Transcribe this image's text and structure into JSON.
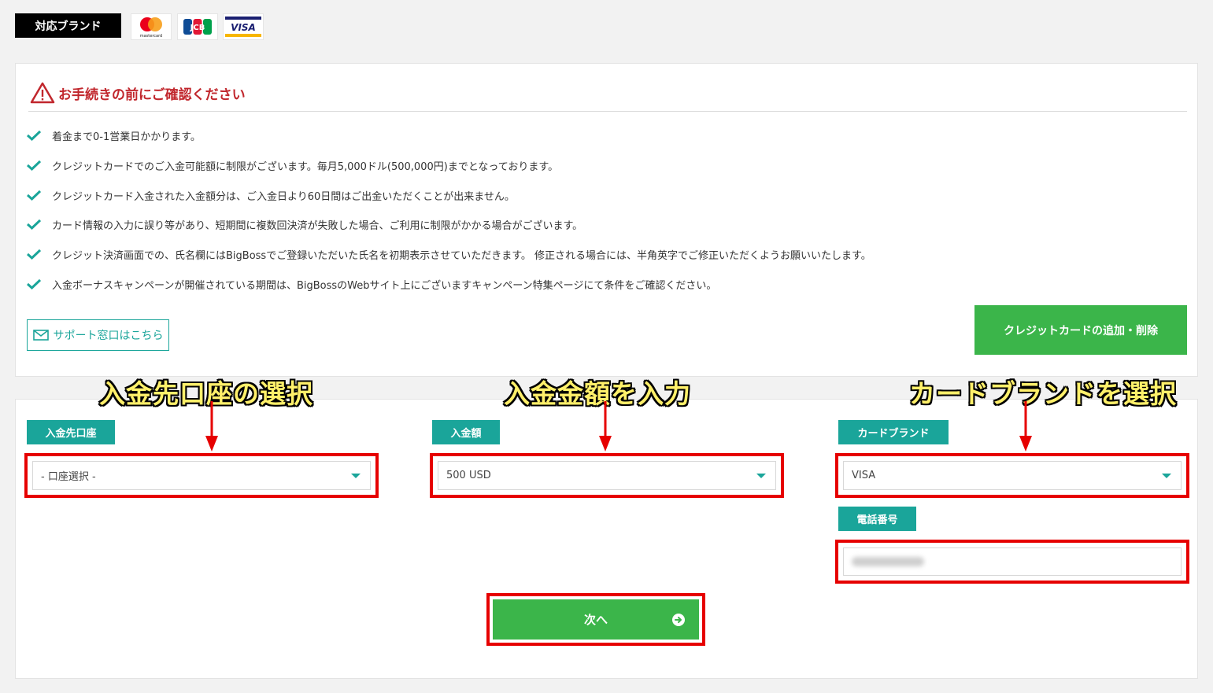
{
  "brand_bar": {
    "label": "対応ブランド",
    "logos": [
      {
        "name": "mastercard",
        "text": "mastercard",
        "colors": [
          "#eb001b",
          "#f79e1b"
        ]
      },
      {
        "name": "jcb",
        "text": "JCB"
      },
      {
        "name": "visa",
        "text": "VISA"
      }
    ]
  },
  "notice": {
    "title": "お手続きの前にご確認ください",
    "items": [
      "着金まで0-1営業日かかります。",
      "クレジットカードでのご入金可能額に制限がございます。毎月5,000ドル(500,000円)までとなっております。",
      "クレジットカード入金された入金額分は、ご入金日より60日間はご出金いただくことが出来ません。",
      "カード情報の入力に誤り等があり、短期間に複数回決済が失敗した場合、ご利用に制限がかかる場合がございます。",
      "クレジット決済画面での、氏名欄にはBigBossでご登録いただいた氏名を初期表示させていただきます。 修正される場合には、半角英字でご修正いただくようお願いいたします。",
      "入金ボーナスキャンペーンが開催されている期間は、BigBossのWebサイト上にございますキャンペーン特集ページにて条件をご確認ください。"
    ],
    "support_label": "サポート窓口はこちら",
    "add_card_label": "クレジットカードの追加・削除"
  },
  "annotations": {
    "account": "入金先口座の選択",
    "amount": "入金金額を入力",
    "brand": "カードブランドを選択"
  },
  "form": {
    "account": {
      "label": "入金先口座",
      "value": "- 口座選択 -"
    },
    "amount": {
      "label": "入金額",
      "value": "500 USD"
    },
    "card_brand": {
      "label": "カードブランド",
      "value": "VISA"
    },
    "phone": {
      "label": "電話番号",
      "value": ""
    },
    "next_label": "次へ"
  },
  "colors": {
    "accent_teal": "#1aa59a",
    "button_green": "#3bb54a",
    "highlight_red": "#e60000",
    "warning_red": "#c1272d"
  }
}
